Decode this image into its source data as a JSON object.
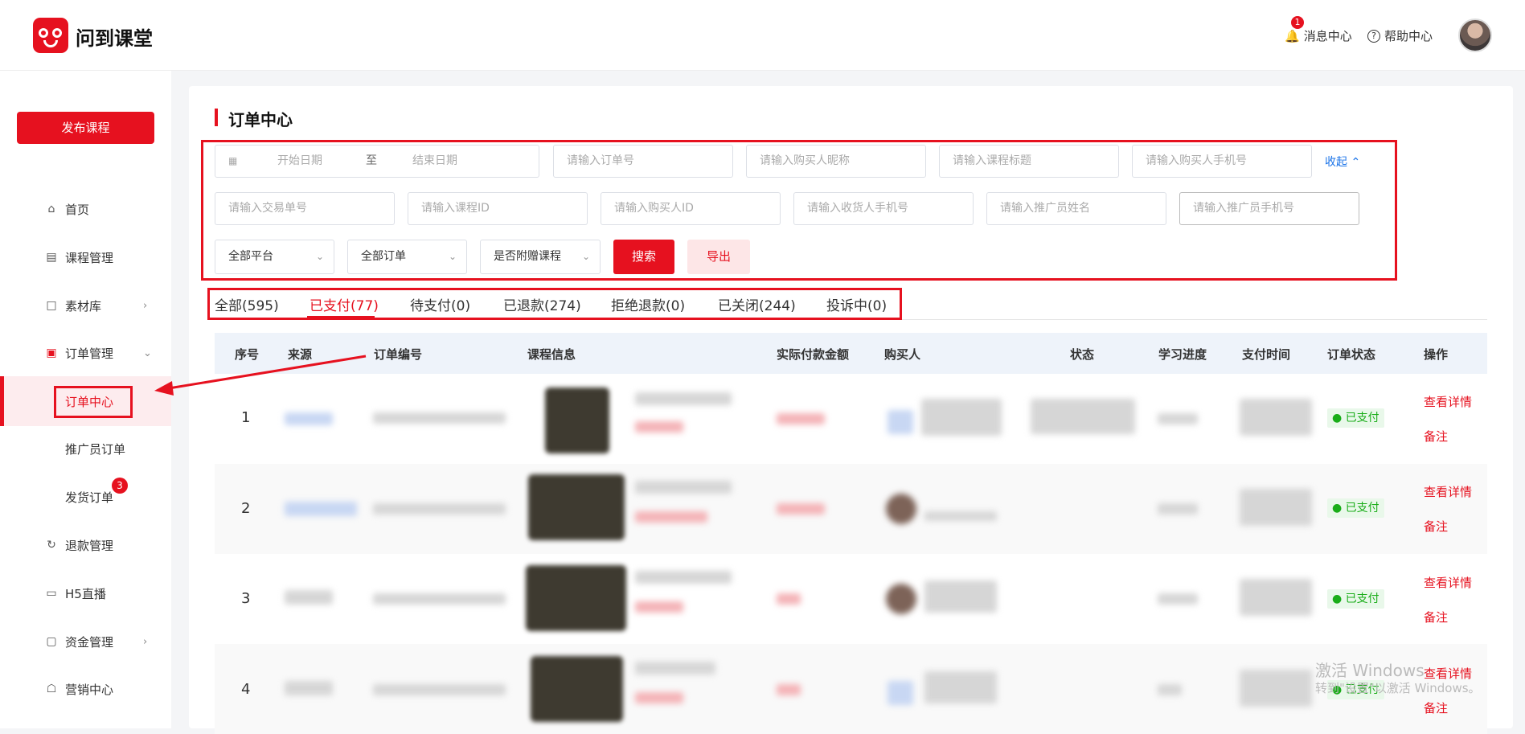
{
  "brand": {
    "name": "问到课堂"
  },
  "header": {
    "notifications_label": "消息中心",
    "notification_count": "1",
    "help_label": "帮助中心"
  },
  "sidebar": {
    "publish_label": "发布课程",
    "items": [
      {
        "label": "首页"
      },
      {
        "label": "课程管理"
      },
      {
        "label": "素材库"
      },
      {
        "label": "订单管理"
      },
      {
        "label": "订单中心"
      },
      {
        "label": "推广员订单"
      },
      {
        "label": "发货订单",
        "badge": "3"
      },
      {
        "label": "退款管理"
      },
      {
        "label": "H5直播"
      },
      {
        "label": "资金管理"
      },
      {
        "label": "营销中心"
      }
    ]
  },
  "page": {
    "title": "订单中心"
  },
  "filters": {
    "start_date": "开始日期",
    "to": "至",
    "end_date": "结束日期",
    "order_no": "请输入订单号",
    "buyer_nick": "请输入购买人昵称",
    "course_title": "请输入课程标题",
    "buyer_phone": "请输入购买人手机号",
    "collapse": "收起",
    "trade_no": "请输入交易单号",
    "course_id": "请输入课程ID",
    "buyer_id": "请输入购买人ID",
    "receiver_phone": "请输入收货人手机号",
    "promoter_name": "请输入推广员姓名",
    "promoter_phone": "请输入推广员手机号",
    "platform": "全部平台",
    "order_type": "全部订单",
    "gift": "是否附赠课程",
    "search": "搜索",
    "export": "导出"
  },
  "tabs": [
    "全部(595)",
    "已支付(77)",
    "待支付(0)",
    "已退款(274)",
    "拒绝退款(0)",
    "已关闭(244)",
    "投诉中(0)"
  ],
  "table": {
    "columns": [
      "序号",
      "来源",
      "订单编号",
      "课程信息",
      "实际付款金额",
      "购买人",
      "状态",
      "学习进度",
      "支付时间",
      "订单状态",
      "操作"
    ],
    "rows": [
      {
        "index": "1",
        "status": "已支付",
        "view": "查看详情",
        "note": "备注"
      },
      {
        "index": "2",
        "status": "已支付",
        "view": "查看详情",
        "note": "备注"
      },
      {
        "index": "3",
        "status": "已支付",
        "view": "查看详情",
        "note": "备注"
      },
      {
        "index": "4",
        "status": "已支付",
        "view": "查看详情",
        "note": "备注"
      }
    ]
  },
  "watermark": {
    "line1": "激活 Windows",
    "line2": "转到\"设置\"以激活 Windows。"
  }
}
